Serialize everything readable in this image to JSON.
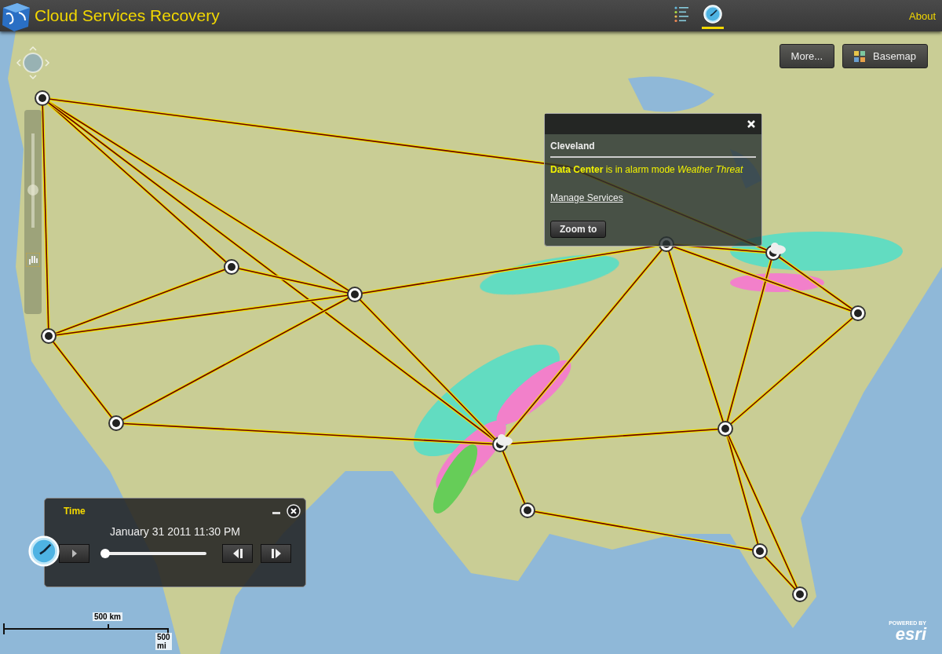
{
  "app": {
    "title": "Cloud Services Recovery",
    "about": "About"
  },
  "toolbar": [
    {
      "kind": "legend",
      "selected": false
    },
    {
      "kind": "time",
      "selected": true
    }
  ],
  "map_buttons": [
    {
      "kind": "more",
      "label": "More..."
    },
    {
      "kind": "basemap",
      "label": "Basemap"
    }
  ],
  "zoom": {
    "level": 0.4
  },
  "popup": {
    "title": "Cleveland",
    "message": "**Data Center** is in alarm mode *Weather Threat*",
    "link": "Manage Services",
    "button": "Zoom to"
  },
  "time": {
    "title": "Time",
    "datetime": "January 31 2011 11:30 PM",
    "level": 0
  },
  "scale": {
    "metric": "500 km",
    "imperial": "500 mi"
  },
  "attribution": {
    "prefix": "POWERED BY",
    "brand": "esri"
  }
}
